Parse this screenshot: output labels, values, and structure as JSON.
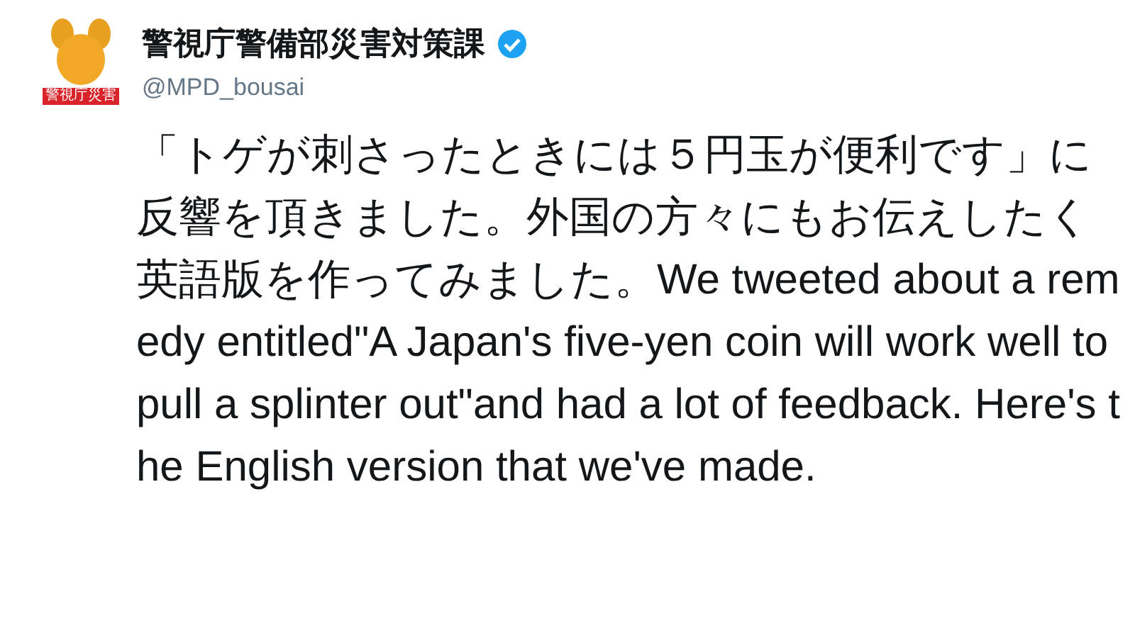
{
  "tweet": {
    "display_name": "警視庁警備部災害対策課",
    "verified": true,
    "handle": "@MPD_bousai",
    "avatar_label": "警視庁災害",
    "text": "「トゲが刺さったときには５円玉が便利です」に反響を頂きました。外国の方々にもお伝えしたく英語版を作ってみました。We tweeted about a remedy entitled\"A Japan's five-yen coin will work well to pull a splinter out\"and had a lot of feedback. Here's the English version that we've made."
  }
}
